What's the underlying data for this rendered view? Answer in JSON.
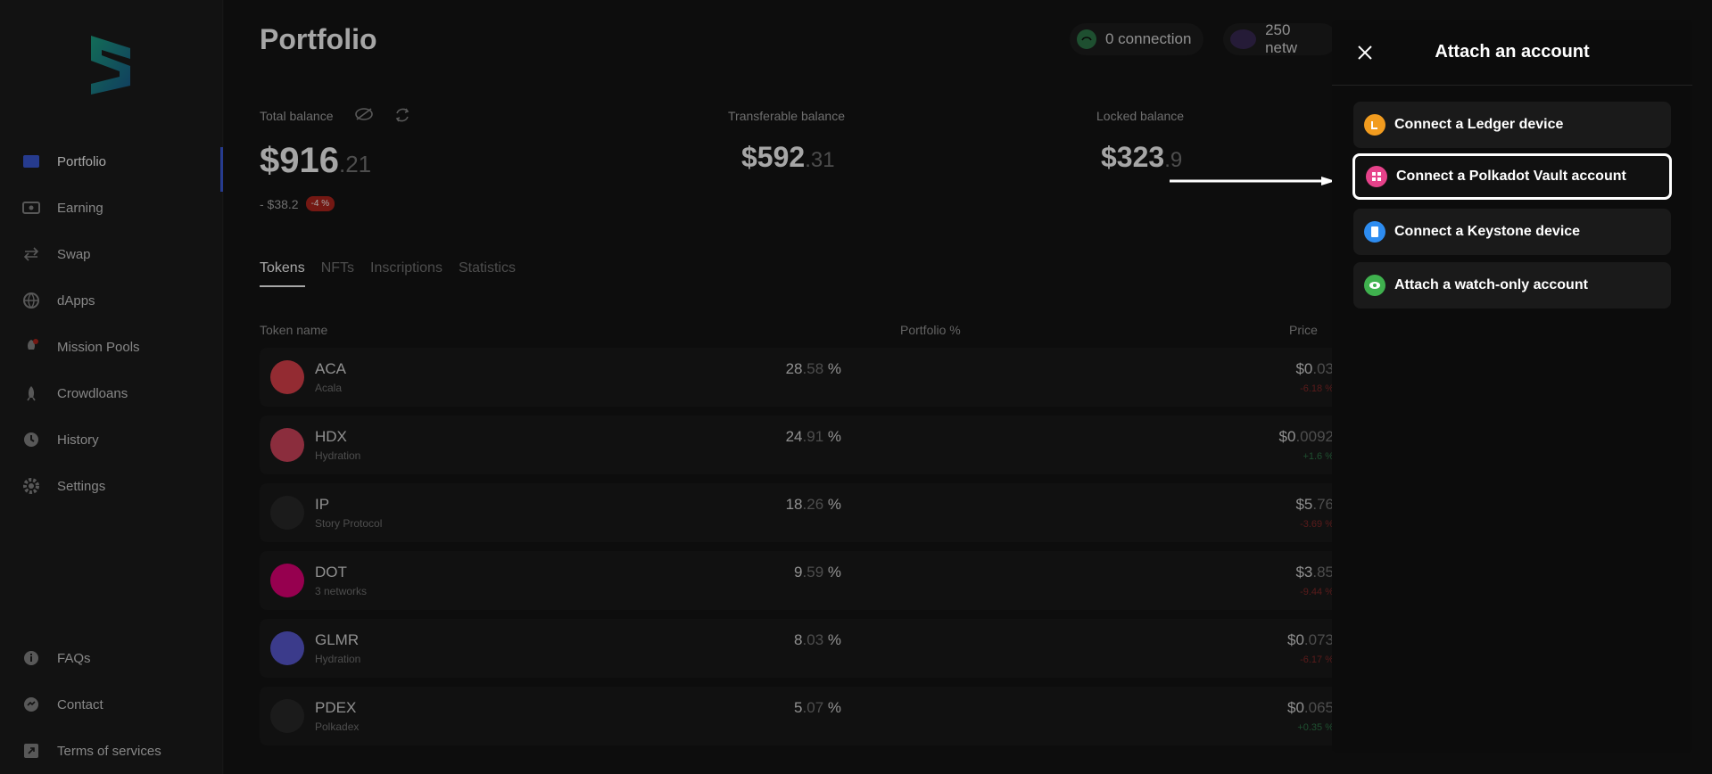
{
  "sidebar": {
    "items": [
      {
        "label": "Portfolio",
        "icon": "wallet-icon"
      },
      {
        "label": "Earning",
        "icon": "earning-icon"
      },
      {
        "label": "Swap",
        "icon": "swap-icon"
      },
      {
        "label": "dApps",
        "icon": "globe-icon"
      },
      {
        "label": "Mission Pools",
        "icon": "rocket-icon"
      },
      {
        "label": "Crowdloans",
        "icon": "crowdloan-icon"
      },
      {
        "label": "History",
        "icon": "clock-icon"
      },
      {
        "label": "Settings",
        "icon": "gear-icon"
      }
    ],
    "bottom": [
      {
        "label": "FAQs",
        "icon": "info-icon"
      },
      {
        "label": "Contact",
        "icon": "chat-icon"
      },
      {
        "label": "Terms of services",
        "icon": "external-link-icon"
      }
    ]
  },
  "header": {
    "title": "Portfolio",
    "connection": "0 connection",
    "networks": "250 netw"
  },
  "balances": {
    "total_label": "Total balance",
    "total_int": "$916",
    "total_dec": ".21",
    "change": "- $38.2",
    "change_pct": "-4 %",
    "transferable_label": "Transferable balance",
    "transferable_int": "$592",
    "transferable_dec": ".31",
    "locked_label": "Locked balance",
    "locked_int": "$323",
    "locked_dec": ".9"
  },
  "tabs": [
    "Tokens",
    "NFTs",
    "Inscriptions",
    "Statistics"
  ],
  "table": {
    "headers": {
      "name": "Token name",
      "portfolio": "Portfolio %",
      "price": "Price"
    },
    "rows": [
      {
        "symbol": "ACA",
        "network": "Acala",
        "pct_int": "28",
        "pct_dec": ".58",
        "pct_sign": " %",
        "price_int": "$0",
        "price_dec": ".03",
        "change": "-6.18 %",
        "up": false,
        "color": "#e2434d"
      },
      {
        "symbol": "HDX",
        "network": "Hydration",
        "pct_int": "24",
        "pct_dec": ".91",
        "pct_sign": " %",
        "price_int": "$0",
        "price_dec": ".0092",
        "change": "+1.6 %",
        "up": true,
        "color": "#d6455f"
      },
      {
        "symbol": "IP",
        "network": "Story Protocol",
        "pct_int": "18",
        "pct_dec": ".26",
        "pct_sign": " %",
        "price_int": "$5",
        "price_dec": ".76",
        "change": "-3.69 %",
        "up": false,
        "color": "#2a2a2a"
      },
      {
        "symbol": "DOT",
        "network": "3 networks",
        "pct_int": "9",
        "pct_dec": ".59",
        "pct_sign": " %",
        "price_int": "$3",
        "price_dec": ".85",
        "change": "-9.44 %",
        "up": false,
        "color": "#e6007a"
      },
      {
        "symbol": "GLMR",
        "network": "Hydration",
        "pct_int": "8",
        "pct_dec": ".03",
        "pct_sign": " %",
        "price_int": "$0",
        "price_dec": ".073",
        "change": "-6.17 %",
        "up": false,
        "color": "#5b5bd6"
      },
      {
        "symbol": "PDEX",
        "network": "Polkadex",
        "pct_int": "5",
        "pct_dec": ".07",
        "pct_sign": " %",
        "price_int": "$0",
        "price_dec": ".065",
        "change": "+0.35 %",
        "up": true,
        "color": "#2a2a2a"
      }
    ]
  },
  "modal": {
    "title": "Attach an account",
    "options": [
      {
        "label": "Connect a Ledger device",
        "icon": "ledger-icon",
        "color": "#f29c1f"
      },
      {
        "label": "Connect a Polkadot Vault account",
        "icon": "vault-icon",
        "color": "#e6428a"
      },
      {
        "label": "Connect a Keystone device",
        "icon": "keystone-icon",
        "color": "#2d8cf0"
      },
      {
        "label": "Attach a watch-only account",
        "icon": "eye-icon",
        "color": "#3fb14e"
      }
    ]
  }
}
